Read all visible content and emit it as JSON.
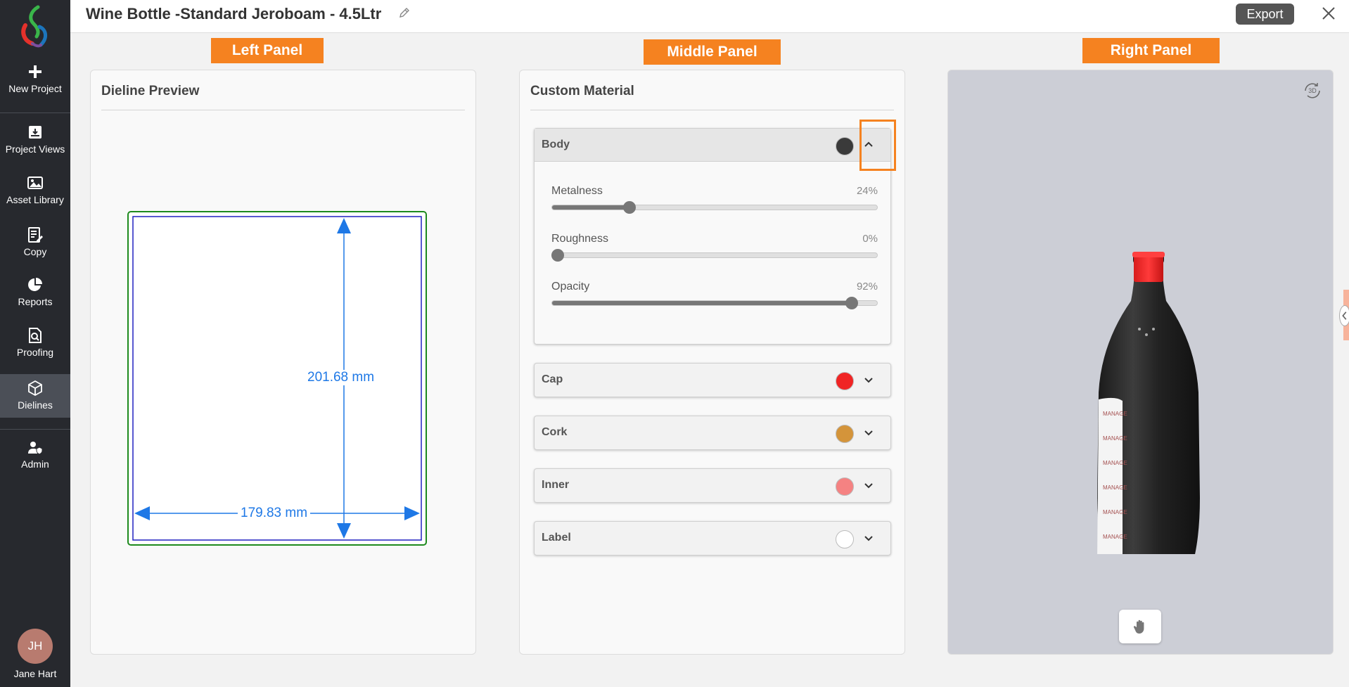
{
  "header": {
    "title": "Wine Bottle -Standard Jeroboam - 4.5Ltr",
    "export_label": "Export"
  },
  "sidebar": {
    "items": [
      {
        "label": "New Project",
        "icon": "plus-icon"
      },
      {
        "label": "Project Views",
        "icon": "archive-icon"
      },
      {
        "label": "Asset Library",
        "icon": "image-icon"
      },
      {
        "label": "Copy",
        "icon": "document-edit-icon"
      },
      {
        "label": "Reports",
        "icon": "pie-chart-icon"
      },
      {
        "label": "Proofing",
        "icon": "search-document-icon"
      },
      {
        "label": "Dielines",
        "icon": "box-icon"
      },
      {
        "label": "Admin",
        "icon": "user-shield-icon"
      }
    ],
    "user": {
      "initials": "JH",
      "name": "Jane Hart"
    }
  },
  "annotations": {
    "left": "Left Panel",
    "middle": "Middle Panel",
    "right": "Right Panel"
  },
  "dieline": {
    "title": "Dieline Preview",
    "height_label": "201.68 mm",
    "width_label": "179.83 mm"
  },
  "material": {
    "title": "Custom Material",
    "body": {
      "label": "Body",
      "color": "#3a3a3a",
      "sliders": [
        {
          "label": "Metalness",
          "value_text": "24%",
          "value": 24
        },
        {
          "label": "Roughness",
          "value_text": "0%",
          "value": 0
        },
        {
          "label": "Opacity",
          "value_text": "92%",
          "value": 92
        }
      ]
    },
    "cap": {
      "label": "Cap",
      "color": "#f02424"
    },
    "cork": {
      "label": "Cork",
      "color": "#d4943a"
    },
    "inner": {
      "label": "Inner",
      "color": "#f58282"
    },
    "label": {
      "label": "Label",
      "color": "#ffffff"
    }
  },
  "viewer": {
    "mode_badge": "3D",
    "label_text": "MANAGE"
  },
  "colors": {
    "accent_orange": "#f58220",
    "dieline_blue": "#1e78e6",
    "sidebar_bg": "#27292e"
  }
}
